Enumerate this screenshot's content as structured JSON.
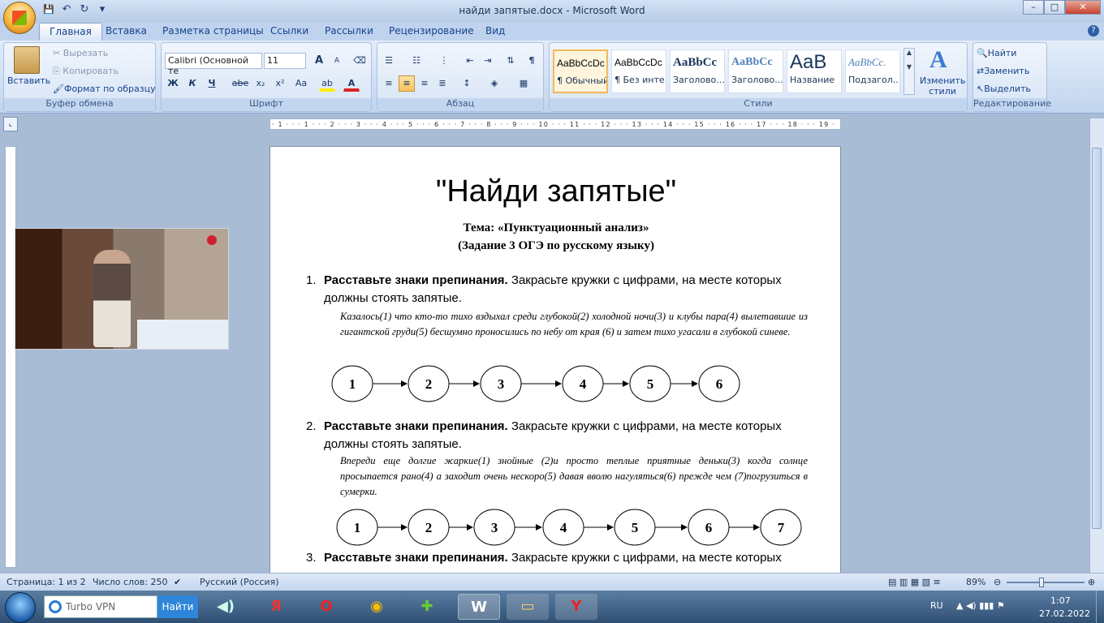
{
  "window": {
    "title": "найди запятые.docx - Microsoft Word",
    "minimize": "–",
    "maximize": "□",
    "close": "✕"
  },
  "qat": {
    "save": "💾",
    "undo": "↶",
    "redo": "↻",
    "more": "▾"
  },
  "tabs": [
    "Главная",
    "Вставка",
    "Разметка страницы",
    "Ссылки",
    "Рассылки",
    "Рецензирование",
    "Вид"
  ],
  "clipboard": {
    "paste": "Вставить",
    "cut": "Вырезать",
    "copy": "Копировать",
    "format_painter": "Формат по образцу",
    "label": "Буфер обмена"
  },
  "font": {
    "name": "Calibri (Основной те",
    "size": "11",
    "grow": "A",
    "shrink": "A",
    "bold": "Ж",
    "italic": "К",
    "underline": "Ч",
    "strike": "abe",
    "sub": "x₂",
    "sup": "x²",
    "case": "Aa",
    "label": "Шрифт"
  },
  "paragraph": {
    "label": "Абзац",
    "pilcrow": "¶"
  },
  "styles": {
    "items": [
      {
        "preview": "AaBbCcDc",
        "name": "¶ Обычный"
      },
      {
        "preview": "AaBbCcDc",
        "name": "¶ Без инте..."
      },
      {
        "preview": "AaBbCc",
        "name": "Заголово..."
      },
      {
        "preview": "AaBbCc",
        "name": "Заголово..."
      },
      {
        "preview": "AaB",
        "name": "Название"
      },
      {
        "preview": "AaBbCc.",
        "name": "Подзагол..."
      }
    ],
    "change": "Изменить стили",
    "label": "Стили"
  },
  "editing": {
    "find": "Найти",
    "replace": "Заменить",
    "select": "Выделить",
    "label": "Редактирование"
  },
  "document": {
    "title": "\"Найди запятые\"",
    "theme": "Тема: «Пунктуационный анализ»",
    "task_note": "(Задание 3 ОГЭ по русскому языку)",
    "tasks": [
      {
        "num": "1.",
        "bold": "Расставьте знаки препинания.",
        "rest": " Закрасьте кружки с цифрами, на месте которых должны стоять запятые.",
        "text": "Казалось(1) что кто-то тихо вздыхал среди глубокой(2) холодной ночи(3) и клубы пара(4) вылетавшие из гигантской груди(5) бесшумно проносились по небу от края (6) и затем тихо угасали в глубокой синеве.",
        "circles": [
          "1",
          "2",
          "3",
          "4",
          "5",
          "6"
        ]
      },
      {
        "num": "2.",
        "bold": "Расставьте знаки препинания.",
        "rest": " Закрасьте кружки с цифрами, на месте которых должны стоять запятые.",
        "text": "Впереди еще долгие жаркие(1) знойные (2)и просто теплые приятные деньки(3) когда солнце просыпается рано(4) а заходит очень нескоро(5) давая вволю нагуляться(6) прежде чем (7)погрузиться в сумерки.",
        "circles": [
          "1",
          "2",
          "3",
          "4",
          "5",
          "6",
          "7"
        ]
      },
      {
        "num": "3.",
        "bold": "Расставьте знаки препинания.",
        "rest": " Закрасьте кружки с цифрами, на месте которых"
      }
    ]
  },
  "status": {
    "page": "Страница: 1 из 2",
    "words": "Число слов: 250",
    "lang": "Русский (Россия)",
    "zoom": "89%"
  },
  "taskbar": {
    "search_placeholder": "Turbo VPN",
    "search_button": "Найти",
    "lang": "RU",
    "time": "1:07",
    "date": "27.02.2022"
  },
  "ruler": {
    "marks": "· 1 · ⸱ · 1 · ⸱ · 2 · ⸱ · 3 · ⸱ · 4 · ⸱ · 5 · ⸱ · 6 · ⸱ · 7 · ⸱ · 8 · ⸱ · 9 · ⸱ · 10 · ⸱ · 11 · ⸱ · 12 · ⸱ · 13 · ⸱ · 14 · ⸱ · 15 · ⸱ · 16 · ⸱ · 17 · ⸱ · 18 · ⸱ · 19 ·"
  }
}
